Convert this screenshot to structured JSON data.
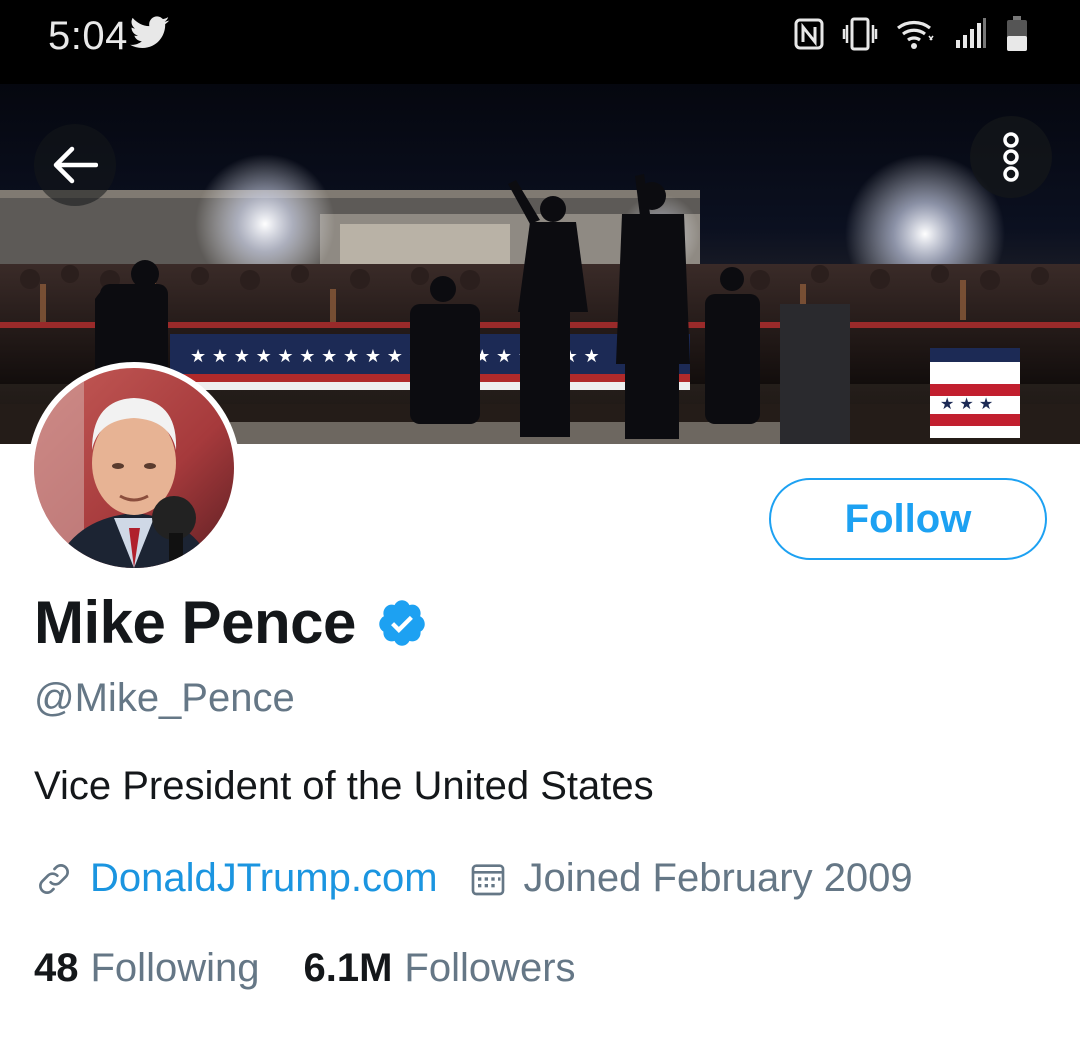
{
  "status_bar": {
    "time": "5:04",
    "icons": [
      "twitter-bird-icon",
      "nfc-icon",
      "vibrate-icon",
      "wifi-icon",
      "signal-icon",
      "battery-icon"
    ]
  },
  "header": {
    "back_icon": "arrow-left-icon",
    "more_icon": "more-vertical-icon"
  },
  "profile": {
    "display_name": "Mike Pence",
    "verified": true,
    "handle": "@Mike_Pence",
    "bio": "Vice President of the United States",
    "website": "DonaldJTrump.com",
    "joined": "Joined February 2009",
    "follow_label": "Follow",
    "following_count": "48",
    "following_label": "Following",
    "followers_count": "6.1M",
    "followers_label": "Followers"
  },
  "colors": {
    "accent": "#1da1f2",
    "link": "#1b95e0",
    "secondary_text": "#657786",
    "primary_text": "#14171a"
  }
}
